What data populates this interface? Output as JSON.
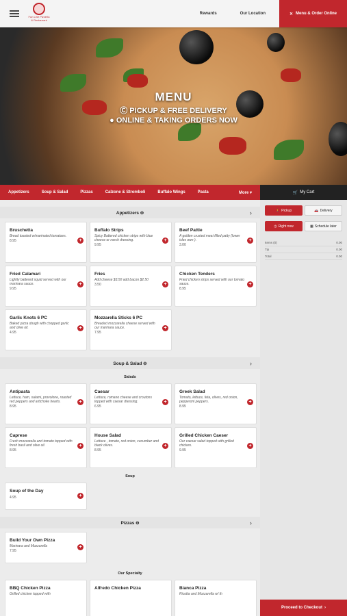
{
  "header": {
    "logo_text": "Fun Line Pizzeria & Restaurant",
    "rewards": "Rewards",
    "location": "Our Location",
    "order": "Menu & Order Online"
  },
  "hero": {
    "title": "MENU",
    "line1": "Ⓒ PICKUP & FREE DELIVERY",
    "line2": "● ONLINE & TAKING ORDERS NOW"
  },
  "nav": {
    "items": [
      "Appetizers",
      "Soup & Salad",
      "Pizzas",
      "Calzone & Stromboli",
      "Buffalo Wings",
      "Pasta"
    ],
    "more": "More ▾",
    "cart": "My Cart"
  },
  "sections": {
    "appetizers": {
      "title": "Appetizers ⊖",
      "items": [
        {
          "name": "Bruschetta",
          "desc": "Bread toasted w/marinated tomatoes.",
          "price": "8.95"
        },
        {
          "name": "Buffalo Strips",
          "desc": "Spicy Battered chicken strips with blue cheese or ranch dressing.",
          "price": "9.95"
        },
        {
          "name": "Beef Pattie",
          "desc": "A golden crusted meat filled patty (lower isles own ).",
          "price": "3.00"
        },
        {
          "name": "Fried Calamari",
          "desc": "Lightly battered squid served with our marinara sauce.",
          "price": "9.95"
        },
        {
          "name": "Fries",
          "desc": "Add cheese $3.50 add bacon $2.50",
          "price": "3.50"
        },
        {
          "name": "Chicken Tenders",
          "desc": "Fried chicken strips served with our tomato sauce.",
          "price": "8.95"
        },
        {
          "name": "Garlic Knots 6 PC",
          "desc": "Baked pizza dough with chopped garlic and olive oil.",
          "price": "4.95"
        },
        {
          "name": "Mozzarella Sticks 6 PC",
          "desc": "Breaded mozzarella cheese served with our marinara sauce.",
          "price": "7.95"
        }
      ]
    },
    "soup": {
      "title": "Soup & Salad ⊖",
      "sub1": "Salads",
      "sub2": "Soup",
      "items": [
        {
          "name": "Antipasta",
          "desc": "Lettuce, ham, salami, provolone, roasted red peppers and artichoke hearts.",
          "price": "8.95"
        },
        {
          "name": "Caesar",
          "desc": "Lettuce, romano cheese and croutons topped with caesar dressing.",
          "price": "6.95"
        },
        {
          "name": "Greek Salad",
          "desc": "Tomato, lettuce, feta, olives, red onion, pepperoni peppers.",
          "price": "8.95"
        },
        {
          "name": "Caprese",
          "desc": "Fresh mozzarella and tomato topped with fresh basil and olive oil.",
          "price": "8.95"
        },
        {
          "name": "House Salad",
          "desc": "Lettuce , tomato, red onion, cucumber and black olives.",
          "price": "8.95"
        },
        {
          "name": "Grilled Chicken Caeser",
          "desc": "Our caesar salad topped with grilled chicken.",
          "price": "9.95"
        }
      ],
      "soup_item": {
        "name": "Soup of the Day",
        "price": "4.95"
      }
    },
    "pizzas": {
      "title": "Pizzas ⊖",
      "byo": {
        "name": "Build Your Own Pizza",
        "desc": "Marinara and Mozzarella",
        "price": "7.95"
      },
      "specialty": "Our Specialty",
      "items": [
        {
          "name": "BBQ Chicken Pizza",
          "desc": "Grilled chicken topped with"
        },
        {
          "name": "Alfredo Chicken Pizza",
          "desc": ""
        },
        {
          "name": "Bianca Pizza",
          "desc": "Ricotta and Mozzarella w/ th"
        }
      ]
    }
  },
  "side": {
    "pickup": "Pickup",
    "delivery": "Delivery",
    "now": "Right now",
    "later": "Schedule later",
    "items_label": "Items (0)",
    "items_val": "0.00",
    "tip_label": "Tip",
    "tip_val": "0.00",
    "total_label": "Total",
    "total_val": "0.00",
    "checkout": "Proceed to Checkout"
  }
}
